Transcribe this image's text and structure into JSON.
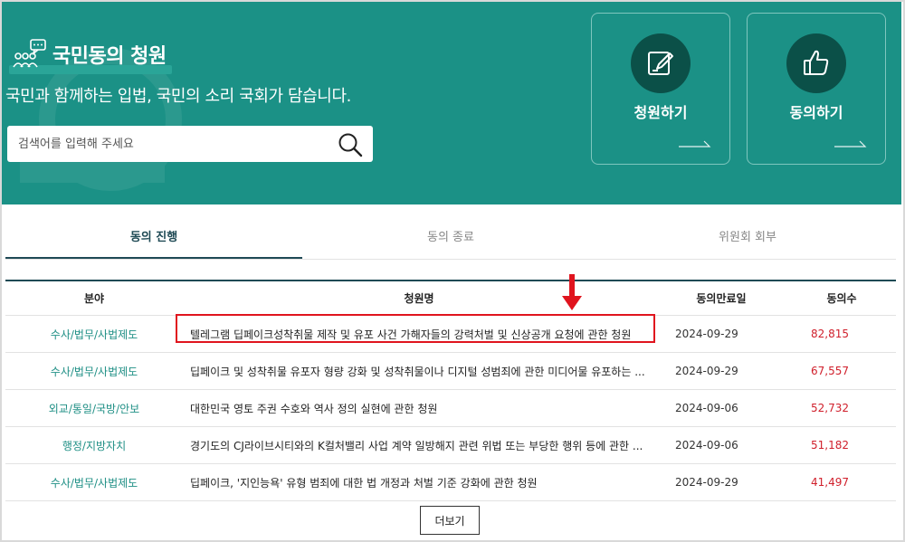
{
  "header": {
    "title": "국민동의 청원",
    "subtitle": "국민과 함께하는 입법, 국민의 소리 국회가 담습니다.",
    "search_placeholder": "검색어를 입력해 주세요"
  },
  "actions": [
    {
      "label": "청원하기",
      "icon": "pencil-note-icon"
    },
    {
      "label": "동의하기",
      "icon": "thumbs-up-icon"
    }
  ],
  "tabs": [
    {
      "label": "동의 진행",
      "active": true
    },
    {
      "label": "동의 종료",
      "active": false
    },
    {
      "label": "위원회 회부",
      "active": false
    }
  ],
  "table": {
    "headers": [
      "분야",
      "청원명",
      "동의만료일",
      "동의수"
    ],
    "rows": [
      {
        "category": "수사/법무/사법제도",
        "title": "텔레그램 딥페이크성착취물 제작 및 유포 사건 가해자들의 강력처벌 및 신상공개 요청에 관한 청원",
        "date": "2024-09-29",
        "count": "82,815"
      },
      {
        "category": "수사/법무/사법제도",
        "title": "딥페이크 및 성착취물 유포자 형량 강화 및 성착취물이나 디지털 성범죄에 관한 미디어물 유포하는 ...",
        "date": "2024-09-29",
        "count": "67,557"
      },
      {
        "category": "외교/통일/국방/안보",
        "title": "대한민국 영토 주권 수호와 역사 정의 실현에 관한 청원",
        "date": "2024-09-06",
        "count": "52,732"
      },
      {
        "category": "행정/지방자치",
        "title": "경기도의 CJ라이브시티와의 K컬처밸리 사업 계약 일방해지 관련 위법 또는 부당한 행위 등에 관한 ...",
        "date": "2024-09-06",
        "count": "51,182"
      },
      {
        "category": "수사/법무/사법제도",
        "title": "딥페이크, '지인능욕' 유형 범죄에 대한 법 개정과 처벌 기준 강화에 관한 청원",
        "date": "2024-09-29",
        "count": "41,497"
      }
    ]
  },
  "more_label": "더보기",
  "colors": {
    "brand_teal": "#1b9186",
    "dark_teal": "#0b5048",
    "count_red": "#d0202c",
    "highlight_red": "#e0141e"
  }
}
